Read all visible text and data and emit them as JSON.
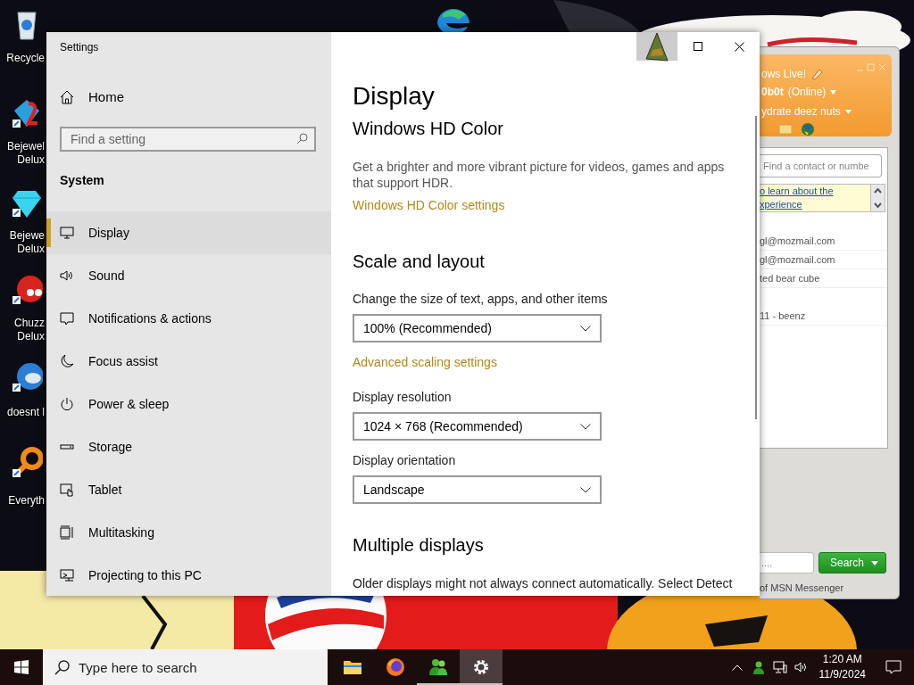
{
  "desktop_icons": [
    {
      "kind": "recycle-bin",
      "label_lines": [
        "Recycle"
      ]
    },
    {
      "kind": "gem-two",
      "label_lines": [
        "Bejewel",
        "Delux"
      ]
    },
    {
      "kind": "gem",
      "label_lines": [
        "Bejewe",
        "Delux"
      ]
    },
    {
      "kind": "creature",
      "label_lines": [
        "Chuzz",
        "Delux"
      ]
    },
    {
      "kind": "bird",
      "label_lines": [
        "doesnt l"
      ]
    },
    {
      "kind": "ring",
      "label_lines": [
        "Everyth"
      ]
    },
    {
      "kind": "browser"
    }
  ],
  "settings": {
    "title": "Settings",
    "home": "Home",
    "search_placeholder": "Find a setting",
    "section": "System",
    "nav": [
      {
        "label": "Display",
        "kind": "monitor",
        "selected": true
      },
      {
        "label": "Sound",
        "kind": "speaker",
        "selected": false
      },
      {
        "label": "Notifications & actions",
        "kind": "message",
        "selected": false
      },
      {
        "label": "Focus assist",
        "kind": "moon",
        "selected": false
      },
      {
        "label": "Power & sleep",
        "kind": "power",
        "selected": false
      },
      {
        "label": "Storage",
        "kind": "storage",
        "selected": false
      },
      {
        "label": "Tablet",
        "kind": "tablet",
        "selected": false
      },
      {
        "label": "Multitasking",
        "kind": "multitask",
        "selected": false
      },
      {
        "label": "Projecting to this PC",
        "kind": "project",
        "selected": false
      }
    ],
    "page_title": "Display",
    "blocks": [
      {
        "kind": "heading",
        "text": "Windows HD Color"
      },
      {
        "kind": "paragraph",
        "text": "Get a brighter and more vibrant picture for videos, games and apps that support HDR.",
        "cut_off": false
      },
      {
        "kind": "link",
        "text": "Windows HD Color settings"
      },
      {
        "kind": "heading",
        "text": "Scale and layout"
      },
      {
        "kind": "label",
        "text": "Change the size of text, apps, and other items"
      },
      {
        "kind": "dropdown",
        "value": "100% (Recommended)"
      },
      {
        "kind": "link",
        "text": "Advanced scaling settings"
      },
      {
        "kind": "label",
        "text": "Display resolution"
      },
      {
        "kind": "dropdown",
        "value": "1024 × 768 (Recommended)"
      },
      {
        "kind": "label",
        "text": "Display orientation"
      },
      {
        "kind": "dropdown",
        "value": "Landscape"
      },
      {
        "kind": "heading",
        "text": "Multiple displays"
      },
      {
        "kind": "paragraph",
        "text": "Older displays might not always connect automatically. Select Detect",
        "cut_off": true
      }
    ]
  },
  "messenger": {
    "title_fragment": "ows Live!",
    "name": "0b0t",
    "status": "(Online)",
    "personal_message": "ydrate deez nuts",
    "search_placeholder": "Find a contact or numbe",
    "banner_lines": [
      "o learn about the",
      "xperience"
    ],
    "contacts": [
      "gl@mozmail.com",
      "gl@mozmail.com",
      "ted bear cube",
      "11 - beenz"
    ],
    "web_search_placeholder": "....",
    "search_button": "Search",
    "footer": "of MSN Messenger"
  },
  "taskbar": {
    "search_placeholder": "Type here to search",
    "apps": [
      {
        "kind": "folder",
        "running": false,
        "selected": false
      },
      {
        "kind": "firefox",
        "running": false,
        "selected": false
      },
      {
        "kind": "messenger",
        "running": true,
        "selected": false
      },
      {
        "kind": "settings",
        "running": true,
        "selected": true
      }
    ],
    "time": "1:20 AM",
    "date": "11/9/2024"
  }
}
